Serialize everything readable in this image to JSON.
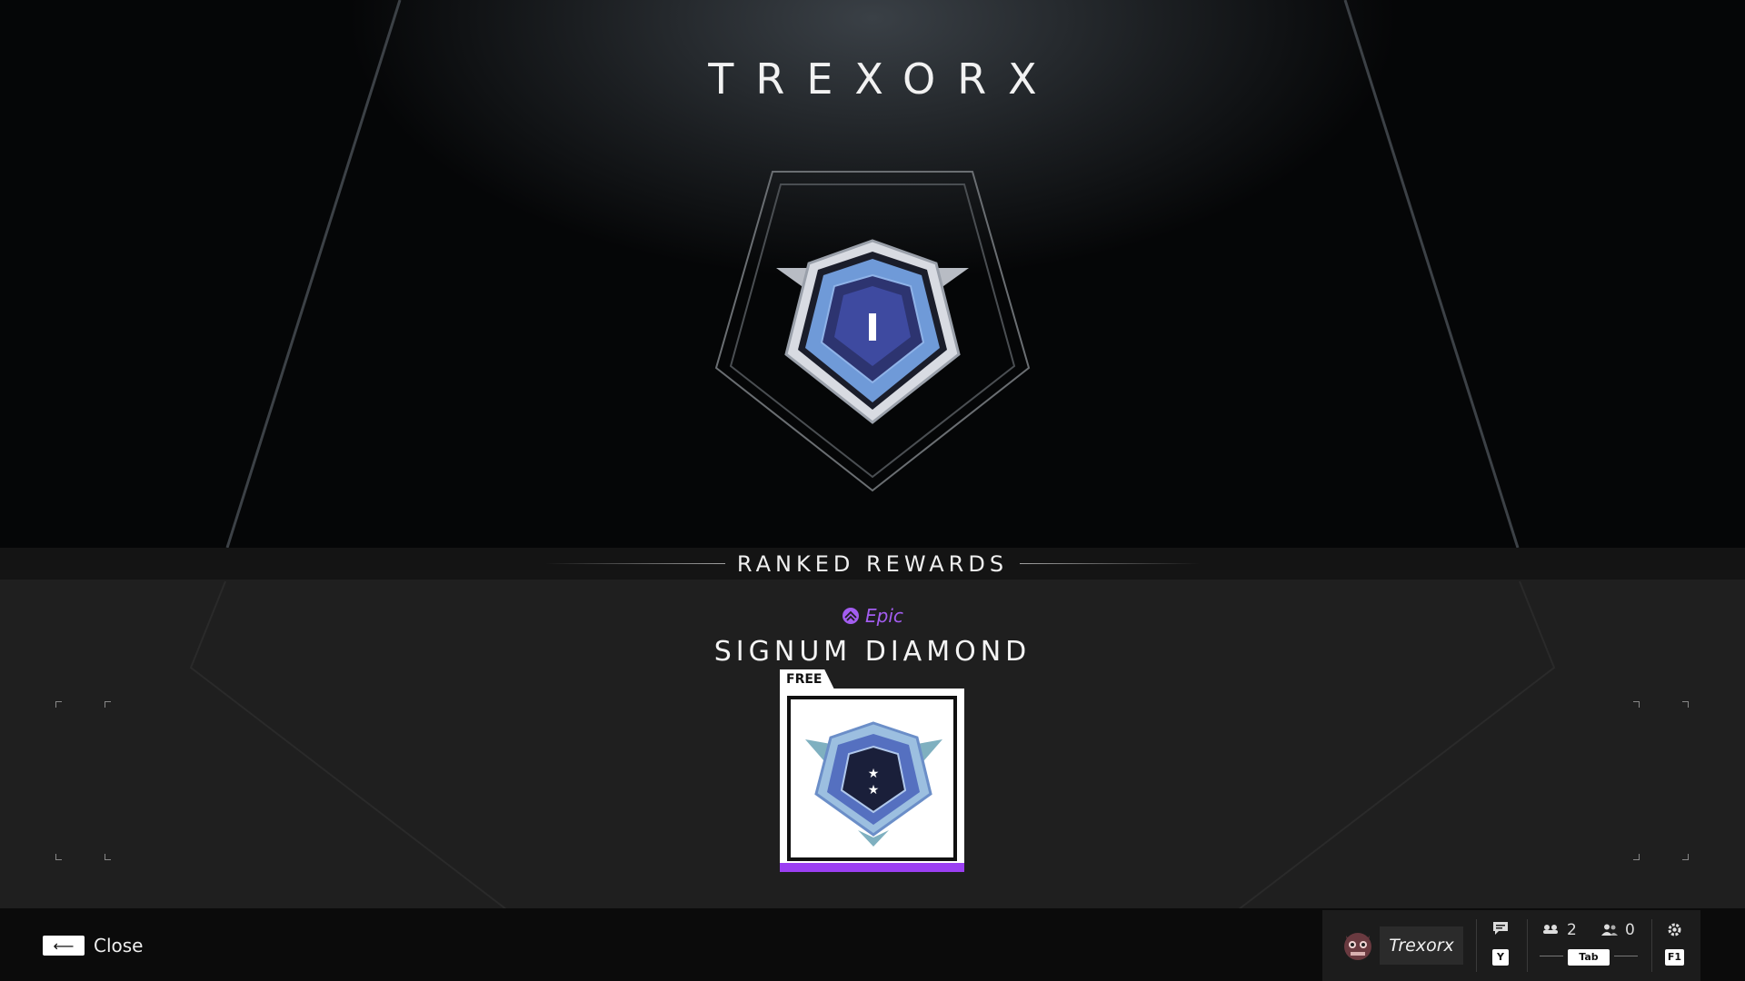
{
  "header": {
    "player_name": "TREXORX"
  },
  "rewards": {
    "section_title": "RANKED REWARDS",
    "rarity_label": "Epic",
    "rarity_color": "#a35df0",
    "item_name": "SIGNUM DIAMOND",
    "tag_label": "FREE"
  },
  "footer": {
    "close_label": "Close",
    "username": "Trexorx",
    "chat_key": "Y",
    "party_count": "2",
    "friends_count": "0",
    "social_key": "Tab",
    "settings_key": "F1"
  },
  "icons": {
    "back_arrow": "arrow-left-icon",
    "rarity": "epic-rarity-icon",
    "chat": "chat-icon",
    "party": "party-icon",
    "friends": "friends-icon",
    "settings": "gear-icon"
  },
  "colors": {
    "epic": "#9b3ff2",
    "accent_blue": "#5a78c8"
  }
}
